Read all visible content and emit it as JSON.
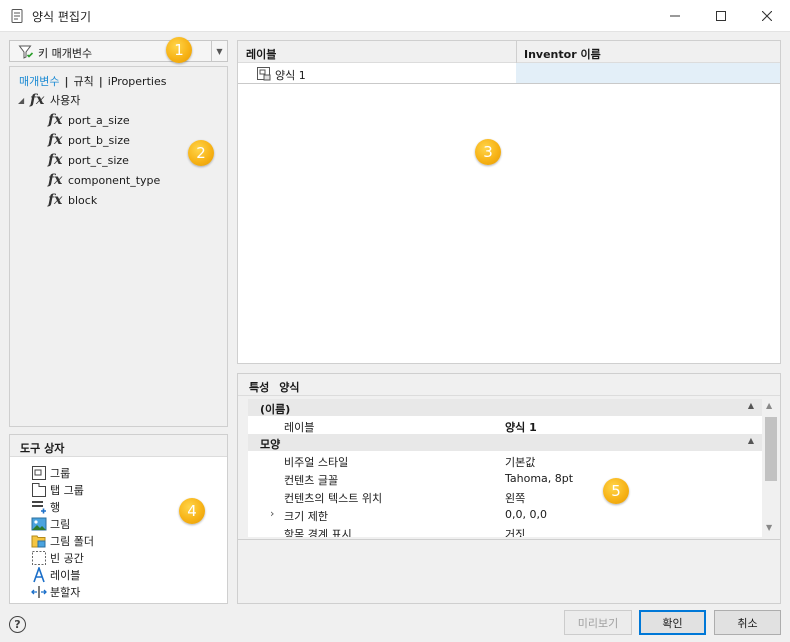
{
  "window": {
    "title": "양식 편집기"
  },
  "param_filter": {
    "label": "키 매개변수"
  },
  "left_panel": {
    "tabs": [
      "매개변수",
      "규칙",
      "iProperties"
    ],
    "tree_root": "사용자",
    "items": [
      "port_a_size",
      "port_b_size",
      "port_c_size",
      "component_type",
      "block"
    ]
  },
  "toolbox": {
    "title": "도구 상자",
    "items": [
      {
        "label": "그룹",
        "icon": "group-icon"
      },
      {
        "label": "탭 그룹",
        "icon": "tab-group-icon"
      },
      {
        "label": "행",
        "icon": "row-icon"
      },
      {
        "label": "그림",
        "icon": "picture-icon"
      },
      {
        "label": "그림 폴더",
        "icon": "picture-folder-icon"
      },
      {
        "label": "빈 공간",
        "icon": "empty-space-icon"
      },
      {
        "label": "레이블",
        "icon": "label-icon"
      },
      {
        "label": "분할자",
        "icon": "splitter-icon"
      }
    ]
  },
  "form_grid": {
    "columns": [
      "레이블",
      "Inventor 이름"
    ],
    "rows": [
      {
        "label": "양식 1",
        "inventor_name": ""
      }
    ]
  },
  "properties": {
    "header": [
      "특성",
      "양식"
    ],
    "categories": [
      {
        "name": "(이름)",
        "rows": [
          {
            "name": "레이블",
            "value": "양식 1"
          }
        ]
      },
      {
        "name": "모양",
        "rows": [
          {
            "name": "비주얼 스타일",
            "value": "기본값"
          },
          {
            "name": "컨텐츠 글꼴",
            "value": "Tahoma, 8pt"
          },
          {
            "name": "컨텐츠의 텍스트 위치",
            "value": "왼쪽"
          },
          {
            "name": "크기 제한",
            "value": "0,0, 0,0"
          },
          {
            "name": "항목 경계 표시",
            "value": "거짓"
          }
        ]
      }
    ]
  },
  "buttons": {
    "preview": "미리보기",
    "ok": "확인",
    "cancel": "취소"
  },
  "callouts": [
    "1",
    "2",
    "3",
    "4",
    "5"
  ],
  "colors": {
    "accent": "#0078d7",
    "tab_active": "#1b8ad3",
    "selected_cell": "#e3eff8",
    "callout": "#f7b317"
  }
}
